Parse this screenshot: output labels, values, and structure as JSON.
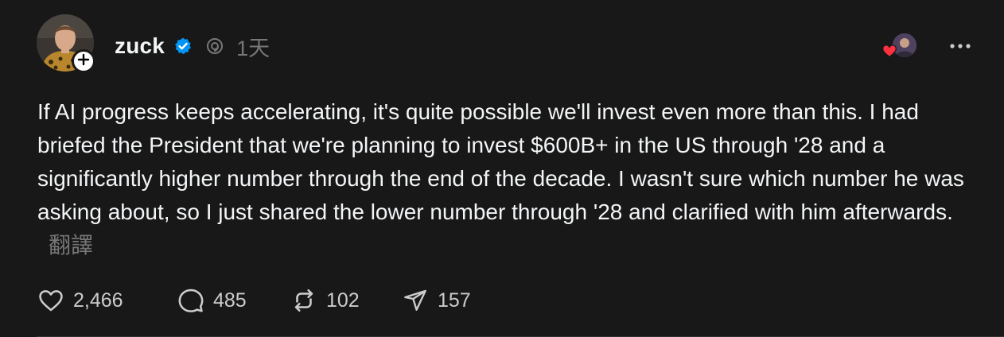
{
  "post": {
    "username": "zuck",
    "timestamp": "1天",
    "body": "If AI progress keeps accelerating, it's quite possible we'll invest even more than this. I had briefed the President that we're planning to invest $600B+ in the US through '28 and a significantly higher number through the end of the decade. I wasn't sure which number he was asking about, so I just shared the lower number through '28 and clarified with him afterwards.",
    "translate_label": "翻譯"
  },
  "stats": {
    "likes": "2,466",
    "replies": "485",
    "reposts": "102",
    "shares": "157"
  },
  "icons": {
    "follow": "plus-icon",
    "verified": "verified-badge-icon",
    "threads": "threads-icon",
    "more": "more-horizontal-icon",
    "like": "heart-icon",
    "reply": "comment-icon",
    "repost": "repost-icon",
    "share": "send-icon"
  },
  "colors": {
    "background": "#181818",
    "text": "#f3f5f7",
    "muted": "#777777",
    "verified": "#0095f6",
    "heart": "#ff3040"
  }
}
